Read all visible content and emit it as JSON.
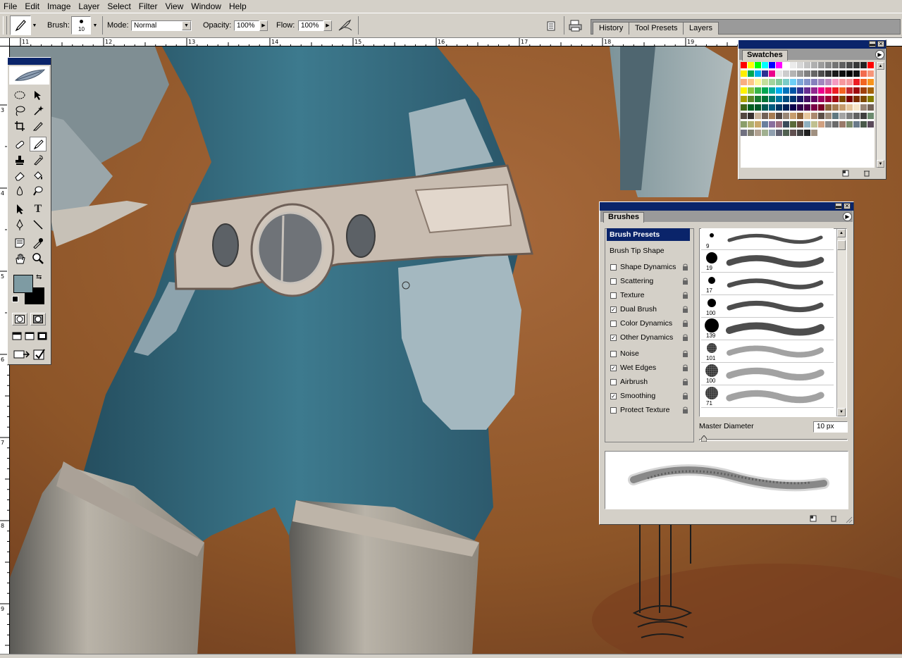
{
  "menu": [
    "File",
    "Edit",
    "Image",
    "Layer",
    "Select",
    "Filter",
    "View",
    "Window",
    "Help"
  ],
  "options_bar": {
    "brush_label": "Brush:",
    "brush_size": "10",
    "mode_label": "Mode:",
    "mode_value": "Normal",
    "opacity_label": "Opacity:",
    "opacity_value": "100%",
    "flow_label": "Flow:",
    "flow_value": "100%"
  },
  "palette_well": {
    "tabs": [
      "History",
      "Tool Presets",
      "Layers"
    ]
  },
  "rulers": {
    "horizontal": [
      "11",
      "12",
      "13",
      "14",
      "15",
      "16",
      "17",
      "18",
      "19"
    ],
    "vertical": [
      "3",
      "4",
      "5",
      "6",
      "7",
      "8",
      "9"
    ]
  },
  "colors": {
    "foreground": "#7e9ba3",
    "background": "#000000",
    "title_blue": "#0a246a",
    "brush_presets_highlight": "#0a246a"
  },
  "swatches": {
    "tab": "Swatches",
    "colors": [
      "#ff0000",
      "#ffff00",
      "#00ff00",
      "#00ffff",
      "#0000ff",
      "#ff00ff",
      "#ffffff",
      "#ebebeb",
      "#d7d7d7",
      "#c3c3c3",
      "#afafaf",
      "#9b9b9b",
      "#878787",
      "#737373",
      "#5f5f5f",
      "#4b4b4b",
      "#373737",
      "#232323",
      "#ff0000",
      "#ffee00",
      "#00a651",
      "#00aeef",
      "#2e3192",
      "#ec008c",
      "#e6e6e6",
      "#cccccc",
      "#b3b3b3",
      "#999999",
      "#808080",
      "#666666",
      "#4d4d4d",
      "#333333",
      "#1a1a1a",
      "#0d0d0d",
      "#000000",
      "#111111",
      "#f26c4f",
      "#f69679",
      "#f9ad81",
      "#fdc689",
      "#fff799",
      "#c4df9b",
      "#a3d39c",
      "#82ca9c",
      "#7accc8",
      "#6dcff6",
      "#7ea7d8",
      "#8393ca",
      "#8781bd",
      "#a187be",
      "#bc8cbf",
      "#f49ac2",
      "#f6989d",
      "#f5989d",
      "#ed1c24",
      "#f26522",
      "#f7941d",
      "#fff200",
      "#8dc63f",
      "#39b54a",
      "#00a651",
      "#00a99d",
      "#00aeef",
      "#0072bc",
      "#0054a6",
      "#2e3192",
      "#662d91",
      "#92278f",
      "#ec008c",
      "#ed145b",
      "#ed1c24",
      "#f26522",
      "#c1272d",
      "#9e0b0f",
      "#a0410d",
      "#a3620a",
      "#aba000",
      "#598527",
      "#1a7b30",
      "#007236",
      "#00746b",
      "#0076a3",
      "#004b80",
      "#003471",
      "#1b1464",
      "#440e62",
      "#630460",
      "#9e005d",
      "#9e0039",
      "#9e0b0f",
      "#7d4900",
      "#790000",
      "#7b2e00",
      "#7d4900",
      "#827b00",
      "#406618",
      "#005e20",
      "#005826",
      "#005952",
      "#005b7f",
      "#003663",
      "#002157",
      "#0d004c",
      "#32004b",
      "#4b0049",
      "#7b0046",
      "#7a0026",
      "#8c6239",
      "#a67c52",
      "#c69c6d",
      "#e6c69c",
      "#f6e6c9",
      "#998675",
      "#736357",
      "#534741",
      "#362f2d",
      "#c7b299",
      "#736357",
      "#a67c52",
      "#534741",
      "#998675",
      "#c69c6d",
      "#8c6239",
      "#e6c69c",
      "#ab8a6f",
      "#5b4f47",
      "#9a8a7a",
      "#5f7880",
      "#a4a4a4",
      "#7f7f7f",
      "#626262",
      "#3f3f3f",
      "#6c8a6e",
      "#8b9e6a",
      "#b0b070",
      "#c9a86a",
      "#6a7f9e",
      "#8a6e9e",
      "#9e6e7f",
      "#3a4a5a",
      "#5a6a3a",
      "#6a4a3a",
      "#90b0c0",
      "#c0c090",
      "#d0a080",
      "#8a8a8a",
      "#6a6a6a",
      "#9a7a6a",
      "#7a8a6a",
      "#6a7a8a",
      "#4a5a4a",
      "#5a4a5a",
      "#707080",
      "#808070",
      "#b0a090",
      "#a0b090",
      "#90a0b0",
      "#606070",
      "#506050",
      "#605050",
      "#404040",
      "#202020",
      "#a09080"
    ]
  },
  "brushes": {
    "tab": "Brushes",
    "options": [
      {
        "label": "Brush Presets",
        "checked": null,
        "header": true
      },
      {
        "label": "Brush Tip Shape",
        "checked": null,
        "header": false
      },
      {
        "label": "Shape Dynamics",
        "checked": false
      },
      {
        "label": "Scattering",
        "checked": false
      },
      {
        "label": "Texture",
        "checked": false
      },
      {
        "label": "Dual Brush",
        "checked": true
      },
      {
        "label": "Color Dynamics",
        "checked": false
      },
      {
        "label": "Other Dynamics",
        "checked": true
      },
      {
        "label": "Noise",
        "checked": false
      },
      {
        "label": "Wet Edges",
        "checked": true
      },
      {
        "label": "Airbrush",
        "checked": false
      },
      {
        "label": "Smoothing",
        "checked": true
      },
      {
        "label": "Protect Texture",
        "checked": false
      }
    ],
    "presets": [
      "9",
      "19",
      "17",
      "100",
      "139",
      "101",
      "100",
      "71"
    ],
    "master_diameter_label": "Master Diameter",
    "master_diameter_value": "10 px"
  }
}
